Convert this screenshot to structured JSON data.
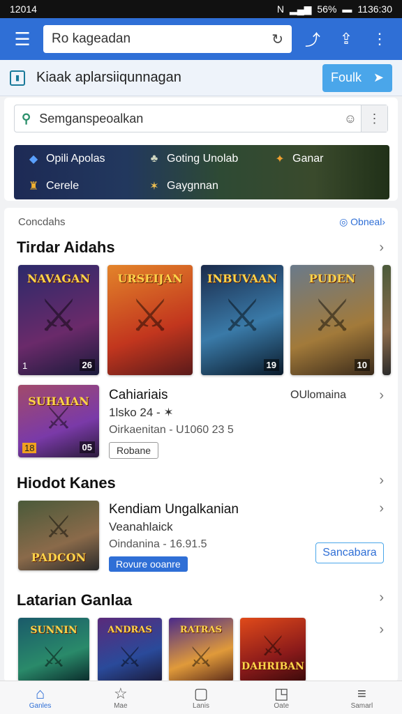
{
  "status": {
    "time_left": "12014",
    "battery": "56%",
    "time_right": "1136:30"
  },
  "appbar": {
    "url_text": "Ro kageadan"
  },
  "banner": {
    "text": "Kiaak aplarsiiqunnagan",
    "button": "Foulk"
  },
  "search": {
    "placeholder": "Semganspeoalkan"
  },
  "categories": [
    {
      "label": "Opili Apolas",
      "icon": "app-icon"
    },
    {
      "label": "Goting Unolab",
      "icon": "gaming-icon"
    },
    {
      "label": "Ganar",
      "icon": "puzzle-icon"
    },
    {
      "label": "Cerele",
      "icon": "cup-icon"
    },
    {
      "label": "Gaygnnan",
      "icon": "star-icon"
    }
  ],
  "section1": {
    "top_label": "Concdahs",
    "top_link": "Obneal",
    "title": "Tirdar Aidahs",
    "tiles": [
      {
        "title": "NAVAGAN",
        "num": "26",
        "lnum": "1"
      },
      {
        "title": "URSEIJAN",
        "num": "",
        "lnum": ""
      },
      {
        "title": "INBUVAAN",
        "num": "19",
        "lnum": ""
      },
      {
        "title": "PUDEN",
        "num": "10",
        "lnum": ""
      }
    ],
    "feature": {
      "tile_title": "SUHAIAN",
      "tile_num": "05",
      "tile_lnum": "18",
      "name": "Cahiariais",
      "line": "1lsko 24 - ✶",
      "meta": "Oirkaenitan - U1060 23 5",
      "pill": "Robane",
      "side_label": "OUlomaina"
    }
  },
  "section2": {
    "title": "Hiodot Kanes",
    "item": {
      "tile_title": "PADCON",
      "name": "Kendiam Ungalkanian",
      "sub": "Veanahlaick",
      "meta": "Oindanina - 16.91.5",
      "pill": "Rovure ooanre",
      "button": "Sancabara"
    }
  },
  "section3": {
    "title": "Latarian Ganlaa",
    "tiles": [
      {
        "title": "SUNNIN"
      },
      {
        "title": "ANDRAS"
      },
      {
        "title": "RATRAS"
      },
      {
        "title": "DAHRIBAN"
      }
    ]
  },
  "bottomnav": [
    {
      "label": "Ganles",
      "icon": "home-icon"
    },
    {
      "label": "Mae",
      "icon": "star-icon"
    },
    {
      "label": "Lanis",
      "icon": "square-icon"
    },
    {
      "label": "Oate",
      "icon": "notification-icon"
    },
    {
      "label": "Samarl",
      "icon": "menu-icon"
    }
  ],
  "colors": {
    "accent": "#2f6fd6",
    "button": "#4aa6ea"
  }
}
